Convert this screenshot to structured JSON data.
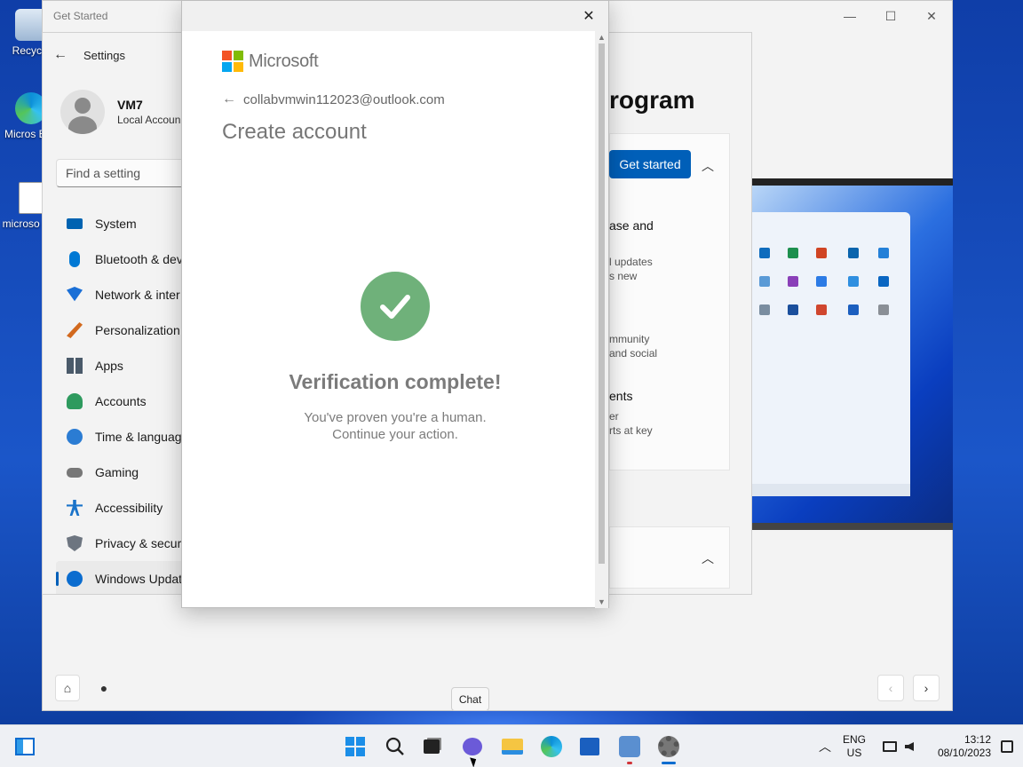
{
  "desktop": {
    "icons": [
      {
        "label": "Recycle",
        "icon": "recycle-bin-icon"
      },
      {
        "label": "Micros Edg",
        "icon": "edge-icon"
      },
      {
        "label": "microso pas",
        "icon": "text-file-icon"
      }
    ]
  },
  "get_started_window": {
    "title": "Get Started",
    "caption": {
      "minimize": "—",
      "maximize": "☐",
      "close": "✕"
    },
    "nav": {
      "back": "‹",
      "forward": "›"
    }
  },
  "settings": {
    "title": "Settings",
    "back": "←",
    "user": {
      "name": "VM7",
      "type": "Local Accoun"
    },
    "search_placeholder": "Find a setting",
    "nav_items": [
      {
        "label": "System",
        "icon": "system-icon",
        "color": "#0063b1"
      },
      {
        "label": "Bluetooth & dev",
        "icon": "bluetooth-icon",
        "color": "#0078d4"
      },
      {
        "label": "Network & inter",
        "icon": "wifi-icon",
        "color": "#1a6fd6"
      },
      {
        "label": "Personalization",
        "icon": "brush-icon",
        "color": "#d2691e"
      },
      {
        "label": "Apps",
        "icon": "apps-icon",
        "color": "#4a5a6a"
      },
      {
        "label": "Accounts",
        "icon": "accounts-icon",
        "color": "#2e9a5e"
      },
      {
        "label": "Time & languag",
        "icon": "time-language-icon",
        "color": "#2b7cd3"
      },
      {
        "label": "Gaming",
        "icon": "gaming-icon",
        "color": "#777777"
      },
      {
        "label": "Accessibility",
        "icon": "accessibility-icon",
        "color": "#1a73c9"
      },
      {
        "label": "Privacy & securi",
        "icon": "shield-icon",
        "color": "#6d7580"
      },
      {
        "label": "Windows Updat",
        "icon": "update-icon",
        "color": "#0a6ccf"
      }
    ],
    "heading": "rogram",
    "get_started_label": "Get started",
    "fragments": [
      "ase and",
      "l updates",
      "s new",
      "mmunity",
      "and social",
      "ents",
      "er",
      "rts at key"
    ]
  },
  "dialog": {
    "close": "✕",
    "brand": "Microsoft",
    "identity": "collabvmwin112023@outlook.com",
    "back": "←",
    "title": "Create account",
    "verify_title": "Verification complete!",
    "verify_line1": "You've proven you're a human.",
    "verify_line2": "Continue your action.",
    "check_color": "#6fb17a"
  },
  "tooltip": "Chat",
  "taskbar": {
    "language": {
      "top": "ENG",
      "bottom": "US"
    },
    "time": "13:12",
    "date": "08/10/2023"
  }
}
